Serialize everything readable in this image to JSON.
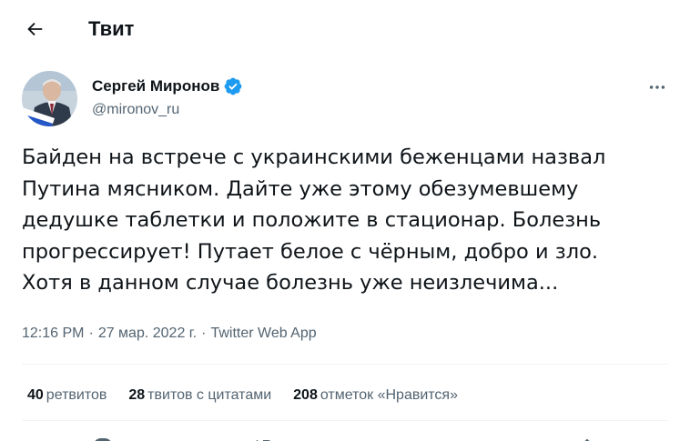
{
  "header": {
    "title": "Твит"
  },
  "author": {
    "display_name": "Сергей Миронов",
    "handle": "@mironov_ru",
    "verified": true
  },
  "tweet": {
    "lines": [
      "Байден на встрече с украинскими беженцами назвал",
      "Путина мясником. Дайте уже этому обезумевшему",
      "дедушке таблетки и положите в стационар. Болезнь",
      "прогрессирует! Путает белое с чёрным, добро и зло.",
      "Хотя в данном случае болезнь уже неизлечима..."
    ],
    "time": "12:16 PM",
    "separator": "·",
    "date": "27 мар. 2022 г.",
    "source": "Twitter Web App"
  },
  "stats": {
    "retweets_count": "40",
    "retweets_label": "ретвитов",
    "quotes_count": "28",
    "quotes_label": "твитов с цитатами",
    "likes_count": "208",
    "likes_label": "отметок «Нравится»"
  },
  "colors": {
    "text": "#0f1419",
    "secondary": "#536471",
    "divider": "#eff3f4",
    "verified": "#1d9bf0"
  },
  "icons": {
    "back": "arrow-left-icon",
    "verified": "verified-badge-icon",
    "more": "more-horizontal-icon",
    "reply": "reply-icon",
    "retweet": "retweet-icon",
    "like": "heart-icon",
    "share": "share-icon"
  }
}
